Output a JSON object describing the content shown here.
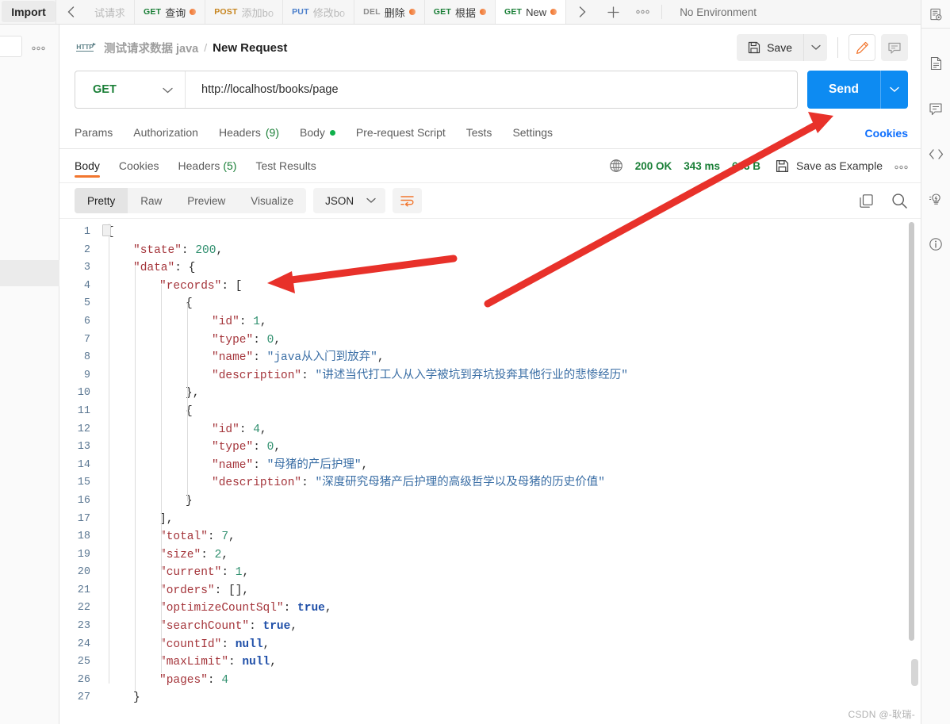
{
  "topbar": {
    "import_label": "Import",
    "scroll_left_icon": "chevron-left-icon",
    "scroll_right_icon": "chevron-right-icon",
    "add_tab_icon": "plus-icon",
    "more_icon": "ellipsis-icon",
    "environment": {
      "selected": "No Environment",
      "chevron": "chevron-down-icon"
    },
    "tabs": [
      {
        "method": "",
        "method_class": "get",
        "name": "试请求",
        "dirty": false,
        "active": false,
        "faded": true
      },
      {
        "method": "GET",
        "method_class": "get",
        "name": "查询",
        "dirty": true,
        "active": false,
        "faded": false
      },
      {
        "method": "POST",
        "method_class": "post",
        "name": "添加bo",
        "dirty": false,
        "active": false,
        "faded": true
      },
      {
        "method": "PUT",
        "method_class": "put",
        "name": "修改bo",
        "dirty": false,
        "active": false,
        "faded": true
      },
      {
        "method": "DEL",
        "method_class": "del",
        "name": "删除",
        "dirty": true,
        "active": false,
        "faded": false
      },
      {
        "method": "GET",
        "method_class": "get",
        "name": "根据",
        "dirty": true,
        "active": false,
        "faded": false
      },
      {
        "method": "GET",
        "method_class": "get",
        "name": "New",
        "dirty": true,
        "active": true,
        "faded": false
      }
    ]
  },
  "sidebar": {
    "more_icon": "ellipsis-icon"
  },
  "rightbar": {
    "icons": [
      "collection-settings-icon",
      "documentation-icon",
      "comment-icon",
      "code-icon",
      "mock-lightbulb-icon",
      "info-icon"
    ]
  },
  "request": {
    "protocol_badge": "HTTP",
    "collection_name": "测试请求数据 java",
    "breadcrumb_separator": "/",
    "title": "New Request",
    "save_label": "Save",
    "save_icon": "floppy-disk-icon",
    "save_dropdown_icon": "chevron-down-icon",
    "edit_icon": "pencil-icon",
    "comment_icon": "comment-icon",
    "method": "GET",
    "method_chevron": "chevron-down-icon",
    "url": "http://localhost/books/page",
    "send_label": "Send",
    "send_dropdown_icon": "chevron-down-icon",
    "cookies_label": "Cookies",
    "tabs": [
      {
        "label": "Params",
        "count": "",
        "dot": false
      },
      {
        "label": "Authorization",
        "count": "",
        "dot": false
      },
      {
        "label": "Headers",
        "count": "(9)",
        "dot": false
      },
      {
        "label": "Body",
        "count": "",
        "dot": true
      },
      {
        "label": "Pre-request Script",
        "count": "",
        "dot": false
      },
      {
        "label": "Tests",
        "count": "",
        "dot": false
      },
      {
        "label": "Settings",
        "count": "",
        "dot": false
      }
    ]
  },
  "response": {
    "tabs": [
      {
        "label": "Body",
        "count": "",
        "active": true
      },
      {
        "label": "Cookies",
        "count": "",
        "active": false
      },
      {
        "label": "Headers",
        "count": "(5)",
        "active": false
      },
      {
        "label": "Test Results",
        "count": "",
        "active": false
      }
    ],
    "globe_icon": "globe-icon",
    "status": "200 OK",
    "time": "343 ms",
    "size": "633 B",
    "save_example_label": "Save as Example",
    "save_example_icon": "floppy-disk-icon",
    "more_icon": "ellipsis-icon",
    "view_modes": [
      {
        "label": "Pretty",
        "active": true
      },
      {
        "label": "Raw",
        "active": false
      },
      {
        "label": "Preview",
        "active": false
      },
      {
        "label": "Visualize",
        "active": false
      }
    ],
    "format": "JSON",
    "format_chevron": "chevron-down-icon",
    "wrap_icon": "word-wrap-icon",
    "copy_icon": "copy-icon",
    "search_icon": "search-icon",
    "body_lines": [
      {
        "n": 1,
        "indent": 0,
        "html": "{"
      },
      {
        "n": 2,
        "indent": 1,
        "html": "<span class=\"k\">\"state\"</span><span class=\"pn\">: </span><span class=\"num\">200</span><span class=\"pn\">,</span>"
      },
      {
        "n": 3,
        "indent": 1,
        "html": "<span class=\"k\">\"data\"</span><span class=\"pn\">: {</span>"
      },
      {
        "n": 4,
        "indent": 2,
        "html": "<span class=\"k\">\"records\"</span><span class=\"pn\">: [</span>"
      },
      {
        "n": 5,
        "indent": 3,
        "html": "<span class=\"pn\">{</span>"
      },
      {
        "n": 6,
        "indent": 4,
        "html": "<span class=\"k\">\"id\"</span><span class=\"pn\">: </span><span class=\"num\">1</span><span class=\"pn\">,</span>"
      },
      {
        "n": 7,
        "indent": 4,
        "html": "<span class=\"k\">\"type\"</span><span class=\"pn\">: </span><span class=\"num\">0</span><span class=\"pn\">,</span>"
      },
      {
        "n": 8,
        "indent": 4,
        "html": "<span class=\"k\">\"name\"</span><span class=\"pn\">: </span><span class=\"str\">\"java从入门到放弃\"</span><span class=\"pn\">,</span>"
      },
      {
        "n": 9,
        "indent": 4,
        "html": "<span class=\"k\">\"description\"</span><span class=\"pn\">: </span><span class=\"str\">\"讲述当代打工人从入学被坑到弃坑投奔其他行业的悲惨经历\"</span>"
      },
      {
        "n": 10,
        "indent": 3,
        "html": "<span class=\"pn\">},</span>"
      },
      {
        "n": 11,
        "indent": 3,
        "html": "<span class=\"pn\">{</span>"
      },
      {
        "n": 12,
        "indent": 4,
        "html": "<span class=\"k\">\"id\"</span><span class=\"pn\">: </span><span class=\"num\">4</span><span class=\"pn\">,</span>"
      },
      {
        "n": 13,
        "indent": 4,
        "html": "<span class=\"k\">\"type\"</span><span class=\"pn\">: </span><span class=\"num\">0</span><span class=\"pn\">,</span>"
      },
      {
        "n": 14,
        "indent": 4,
        "html": "<span class=\"k\">\"name\"</span><span class=\"pn\">: </span><span class=\"str\">\"母猪的产后护理\"</span><span class=\"pn\">,</span>"
      },
      {
        "n": 15,
        "indent": 4,
        "html": "<span class=\"k\">\"description\"</span><span class=\"pn\">: </span><span class=\"str\">\"深度研究母猪产后护理的高级哲学以及母猪的历史价值\"</span>"
      },
      {
        "n": 16,
        "indent": 3,
        "html": "<span class=\"pn\">}</span>"
      },
      {
        "n": 17,
        "indent": 2,
        "html": "<span class=\"pn\">],</span>"
      },
      {
        "n": 18,
        "indent": 2,
        "html": "<span class=\"k\">\"total\"</span><span class=\"pn\">: </span><span class=\"num\">7</span><span class=\"pn\">,</span>"
      },
      {
        "n": 19,
        "indent": 2,
        "html": "<span class=\"k\">\"size\"</span><span class=\"pn\">: </span><span class=\"num\">2</span><span class=\"pn\">,</span>"
      },
      {
        "n": 20,
        "indent": 2,
        "html": "<span class=\"k\">\"current\"</span><span class=\"pn\">: </span><span class=\"num\">1</span><span class=\"pn\">,</span>"
      },
      {
        "n": 21,
        "indent": 2,
        "html": "<span class=\"k\">\"orders\"</span><span class=\"pn\">: [],</span>"
      },
      {
        "n": 22,
        "indent": 2,
        "html": "<span class=\"k\">\"optimizeCountSql\"</span><span class=\"pn\">: </span><span class=\"bool\">true</span><span class=\"pn\">,</span>"
      },
      {
        "n": 23,
        "indent": 2,
        "html": "<span class=\"k\">\"searchCount\"</span><span class=\"pn\">: </span><span class=\"bool\">true</span><span class=\"pn\">,</span>"
      },
      {
        "n": 24,
        "indent": 2,
        "html": "<span class=\"k\">\"countId\"</span><span class=\"pn\">: </span><span class=\"bool\">null</span><span class=\"pn\">,</span>"
      },
      {
        "n": 25,
        "indent": 2,
        "html": "<span class=\"k\">\"maxLimit\"</span><span class=\"pn\">: </span><span class=\"bool\">null</span><span class=\"pn\">,</span>"
      },
      {
        "n": 26,
        "indent": 2,
        "html": "<span class=\"k\">\"pages\"</span><span class=\"pn\">: </span><span class=\"num\">4</span>"
      },
      {
        "n": 27,
        "indent": 1,
        "html": "<span class=\"pn\">}</span>"
      }
    ]
  },
  "annotations": {
    "arrow_color": "#e8312a",
    "arrows": [
      {
        "name": "arrow-to-send-button"
      },
      {
        "name": "arrow-to-data-field"
      }
    ]
  },
  "watermark": "CSDN @-耿瑞-",
  "colors": {
    "accent_orange": "#f2762e",
    "send_blue": "#0d8bf2",
    "status_green": "#1a7f37",
    "link_blue": "#0d6efd"
  }
}
